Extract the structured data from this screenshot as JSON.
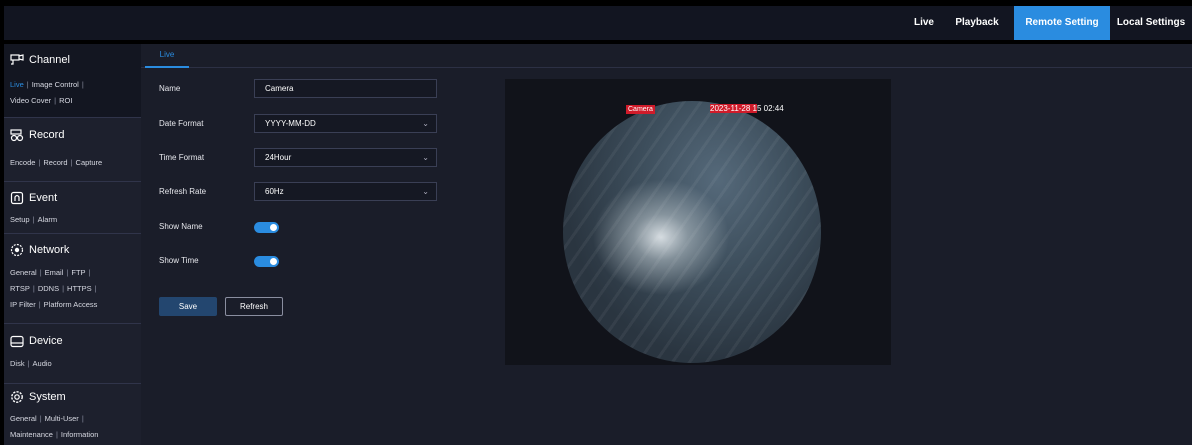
{
  "topnav": {
    "tabs": [
      {
        "label": "Live",
        "active": false
      },
      {
        "label": "Playback",
        "active": false
      },
      {
        "label": "Remote Setting",
        "active": true
      },
      {
        "label": "Local Settings",
        "active": false
      }
    ]
  },
  "sidebar": {
    "sections": [
      {
        "title": "Channel",
        "icon": "channel-icon",
        "links": [
          [
            "Live",
            "Image Control"
          ],
          [
            "Video Cover",
            "ROI"
          ]
        ],
        "active_link": "Live"
      },
      {
        "title": "Record",
        "icon": "record-icon",
        "links": [
          [
            "Encode",
            "Record",
            "Capture"
          ]
        ]
      },
      {
        "title": "Event",
        "icon": "event-icon",
        "links": [
          [
            "Setup",
            "Alarm"
          ]
        ]
      },
      {
        "title": "Network",
        "icon": "network-icon",
        "links": [
          [
            "General",
            "Email",
            "FTP"
          ],
          [
            "RTSP",
            "DDNS",
            "HTTPS"
          ],
          [
            "IP Filter",
            "Platform Access"
          ]
        ]
      },
      {
        "title": "Device",
        "icon": "device-icon",
        "links": [
          [
            "Disk",
            "Audio"
          ]
        ]
      },
      {
        "title": "System",
        "icon": "system-icon",
        "links": [
          [
            "General",
            "Multi-User"
          ],
          [
            "Maintenance",
            "Information"
          ]
        ]
      }
    ]
  },
  "content": {
    "subtab": "Live",
    "form": {
      "name_label": "Name",
      "name_value": "Camera",
      "date_format_label": "Date Format",
      "date_format_value": "YYYY-MM-DD",
      "time_format_label": "Time Format",
      "time_format_value": "24Hour",
      "refresh_rate_label": "Refresh Rate",
      "refresh_rate_value": "60Hz",
      "show_name_label": "Show Name",
      "show_name_on": true,
      "show_time_label": "Show Time",
      "show_time_on": true
    },
    "buttons": {
      "save": "Save",
      "refresh": "Refresh"
    },
    "preview": {
      "osd_name": "Camera",
      "osd_time_highlight": "2023-11-28 1",
      "osd_time_rest": "5 02:44"
    }
  },
  "colors": {
    "accent": "#2a8ce0",
    "osd_red": "#d01b2a",
    "bg": "#1a1d29",
    "sidebar": "#1d202d"
  }
}
